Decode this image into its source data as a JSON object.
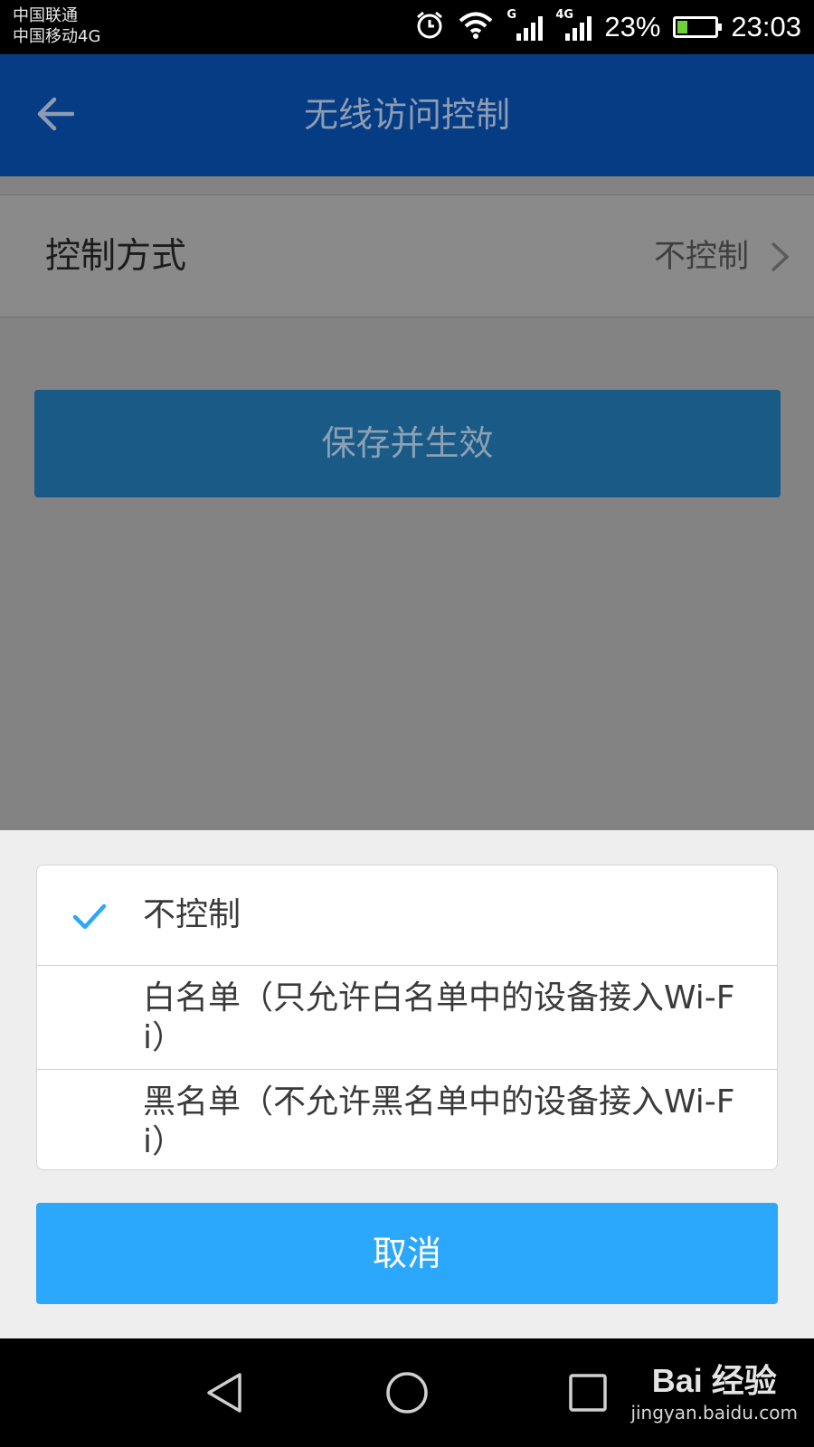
{
  "status_bar": {
    "carrier_1": "中国联通",
    "carrier_2": "中国移动4G",
    "sim1_type": "G",
    "sim2_type": "4G",
    "battery_pct": "23%",
    "battery_level": 0.23,
    "time": "23:03",
    "icons": [
      "alarm-icon",
      "wifi-icon",
      "signal-icon",
      "signal-icon",
      "battery-charging-icon"
    ]
  },
  "header": {
    "title": "无线访问控制",
    "back_icon": "back-arrow-icon"
  },
  "settings_row": {
    "label": "控制方式",
    "value": "不控制"
  },
  "save_button": {
    "label": "保存并生效"
  },
  "sheet": {
    "options": [
      {
        "label": "不控制",
        "selected": true
      },
      {
        "label": "白名单（只允许白名单中的设备接入Wi-Fi）",
        "selected": false
      },
      {
        "label": "黑名单（不允许黑名单中的设备接入Wi-Fi）",
        "selected": false
      }
    ],
    "cancel_label": "取消"
  },
  "watermark": {
    "logo_text": "Bai 经验",
    "url": "jingyan.baidu.com"
  },
  "colors": {
    "header_bg": "#063c84",
    "accent": "#2ba8fb",
    "check": "#2ba8fb",
    "overlay": "#838383"
  }
}
